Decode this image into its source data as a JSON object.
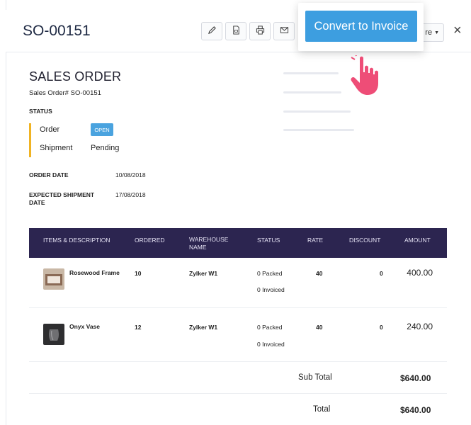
{
  "header": {
    "title": "SO-00151",
    "more_label": "re",
    "close_label": "×"
  },
  "toolbar": {
    "buttons": [
      {
        "icon": "pencil-icon"
      },
      {
        "icon": "pdf-icon"
      },
      {
        "icon": "printer-icon"
      },
      {
        "icon": "mail-icon"
      }
    ]
  },
  "popover": {
    "convert_label": "Convert to Invoice"
  },
  "document": {
    "heading": "SALES ORDER",
    "so_number": "Sales Order# SO-00151",
    "status_label": "STATUS",
    "order_label": "Order",
    "order_badge": "OPEN",
    "shipment_label": "Shipment",
    "shipment_value": "Pending",
    "order_date_label": "ORDER DATE",
    "order_date_value": "10/08/2018",
    "expected_label_1": "EXPECTED SHIPMENT",
    "expected_label_2": "DATE",
    "expected_value": "17/08/2018"
  },
  "table": {
    "columns": [
      "ITEMS & DESCRIPTION",
      "ORDERED",
      "WAREHOUSE",
      "NAME",
      "STATUS",
      "RATE",
      "DISCOUNT",
      "AMOUNT"
    ],
    "rows": [
      {
        "item": "Rosewood Frame",
        "ordered": "10",
        "warehouse": "Zylker W1",
        "status_1": "0 Packed",
        "status_2": "0 Invoiced",
        "rate": "40",
        "discount": "0",
        "amount": "400.00"
      },
      {
        "item": "Onyx Vase",
        "ordered": "12",
        "warehouse": "Zylker W1",
        "status_1": "0 Packed",
        "status_2": "0 Invoiced",
        "rate": "40",
        "discount": "0",
        "amount": "240.00"
      }
    ]
  },
  "totals": {
    "subtotal_label": "Sub Total",
    "subtotal_value": "$640.00",
    "total_label": "Total",
    "total_value": "$640.00"
  },
  "colors": {
    "accent": "#3d9ee0",
    "table_header": "#2c2550",
    "status_bar": "#f0b323",
    "hand": "#ee4d77"
  }
}
